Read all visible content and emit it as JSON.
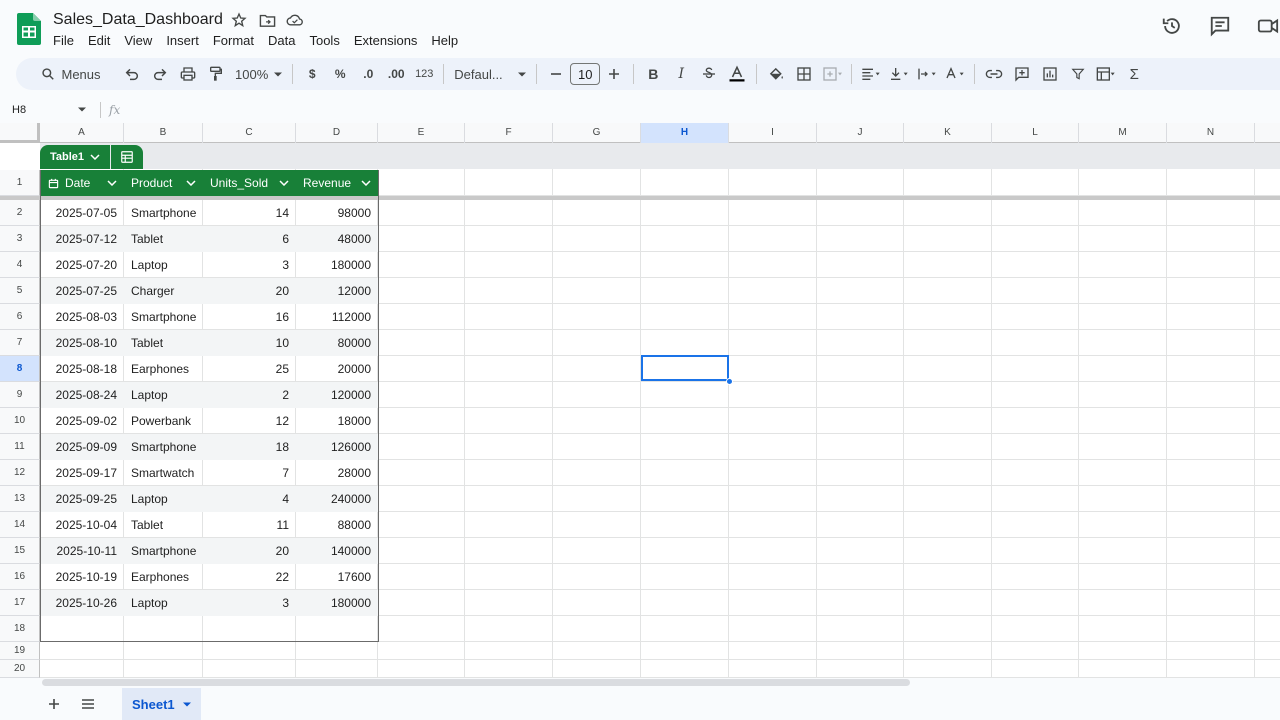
{
  "app": {
    "title": "Sales_Data_Dashboard",
    "menu": [
      "File",
      "Edit",
      "View",
      "Insert",
      "Format",
      "Data",
      "Tools",
      "Extensions",
      "Help"
    ]
  },
  "toolbar": {
    "menus_label": "Menus",
    "zoom": "100%",
    "currency": "$",
    "percent": "%",
    "dec_decrease": ".0",
    "dec_increase": ".00",
    "number_format": "123",
    "font": "Defaul...",
    "font_size": "10"
  },
  "formula_bar": {
    "name_box": "H8",
    "fx": "fx",
    "value": ""
  },
  "grid": {
    "columns": [
      "A",
      "B",
      "C",
      "D",
      "E",
      "F",
      "G",
      "H",
      "I",
      "J",
      "K",
      "L",
      "M",
      "N"
    ],
    "selected_column": "H",
    "rows": [
      "1",
      "2",
      "3",
      "4",
      "5",
      "6",
      "7",
      "8",
      "9",
      "10",
      "11",
      "12",
      "13",
      "14",
      "15",
      "16",
      "17",
      "18",
      "19",
      "20"
    ],
    "selected_row": "8",
    "selected_cell": "H8"
  },
  "table": {
    "name": "Table1",
    "headers": [
      "Date",
      "Product",
      "Units_Sold",
      "Revenue"
    ],
    "rows": [
      [
        "2025-07-05",
        "Smartphone",
        "14",
        "98000"
      ],
      [
        "2025-07-12",
        "Tablet",
        "6",
        "48000"
      ],
      [
        "2025-07-20",
        "Laptop",
        "3",
        "180000"
      ],
      [
        "2025-07-25",
        "Charger",
        "20",
        "12000"
      ],
      [
        "2025-08-03",
        "Smartphone",
        "16",
        "112000"
      ],
      [
        "2025-08-10",
        "Tablet",
        "10",
        "80000"
      ],
      [
        "2025-08-18",
        "Earphones",
        "25",
        "20000"
      ],
      [
        "2025-08-24",
        "Laptop",
        "2",
        "120000"
      ],
      [
        "2025-09-02",
        "Powerbank",
        "12",
        "18000"
      ],
      [
        "2025-09-09",
        "Smartphone",
        "18",
        "126000"
      ],
      [
        "2025-09-17",
        "Smartwatch",
        "7",
        "28000"
      ],
      [
        "2025-09-25",
        "Laptop",
        "4",
        "240000"
      ],
      [
        "2025-10-04",
        "Tablet",
        "11",
        "88000"
      ],
      [
        "2025-10-11",
        "Smartphone",
        "20",
        "140000"
      ],
      [
        "2025-10-19",
        "Earphones",
        "22",
        "17600"
      ],
      [
        "2025-10-26",
        "Laptop",
        "3",
        "180000"
      ]
    ]
  },
  "sheets": {
    "active": "Sheet1"
  },
  "colors": {
    "table_green": "#188038",
    "selection_blue": "#1a73e8",
    "header_selected": "#d3e3fd"
  },
  "icons": {
    "title": [
      "star-icon",
      "move-folder-icon",
      "cloud-saved-icon"
    ],
    "right": [
      "version-history-icon",
      "comments-icon",
      "meet-icon"
    ]
  }
}
